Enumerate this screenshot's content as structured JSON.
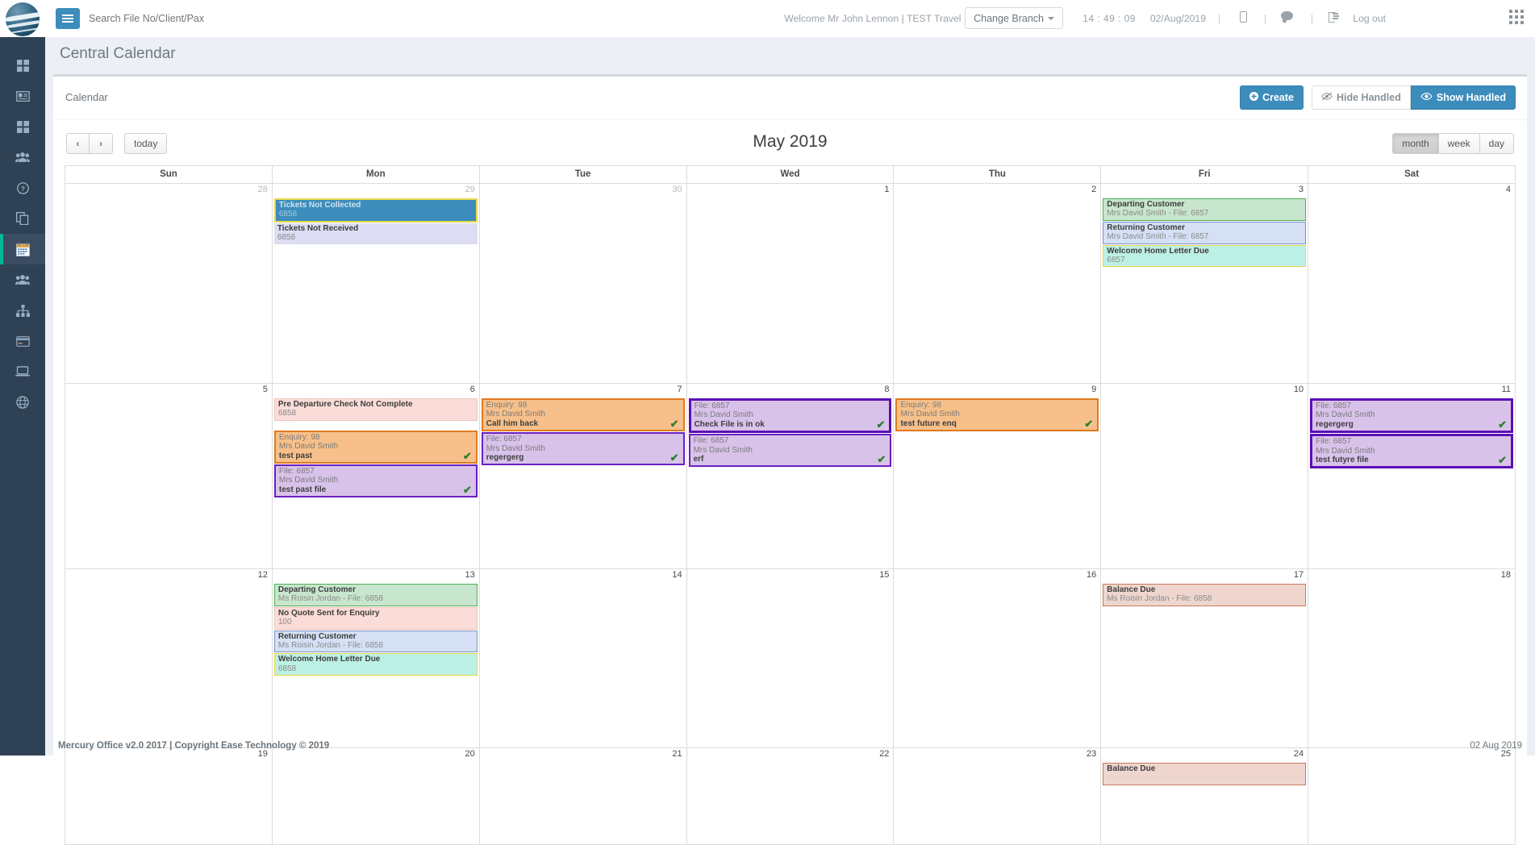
{
  "header": {
    "search_placeholder": "Search File No/Client/Pax",
    "welcome": "Welcome Mr John Lennon | TEST Travel |",
    "change_branch": "Change Branch",
    "time": "14 : 49 : 09",
    "date": "02/Aug/2019",
    "logout": "Log out",
    "separator": "|",
    "icons": {
      "menu": "hamburger-icon",
      "mobile": "mobile-icon",
      "chat": "chat-icon",
      "logout": "sign-out-icon",
      "apps": "apps-grid-icon",
      "logo": "company-logo"
    }
  },
  "sidebar": {
    "items": [
      {
        "name": "dashboard",
        "icon": "grid-icon"
      },
      {
        "name": "id-card",
        "icon": "id-card-icon"
      },
      {
        "name": "modules",
        "icon": "grid-icon"
      },
      {
        "name": "customers",
        "icon": "users-icon"
      },
      {
        "name": "help",
        "icon": "question-circle-icon"
      },
      {
        "name": "documents",
        "icon": "copy-icon"
      },
      {
        "name": "calendar",
        "icon": "calendar-icon",
        "active": true
      },
      {
        "name": "suppliers",
        "icon": "users-group-icon"
      },
      {
        "name": "structure",
        "icon": "sitemap-icon"
      },
      {
        "name": "payments",
        "icon": "credit-card-icon"
      },
      {
        "name": "reports",
        "icon": "laptop-icon"
      },
      {
        "name": "globe",
        "icon": "globe-icon"
      }
    ]
  },
  "page": {
    "title": "Central Calendar",
    "card_title": "Calendar"
  },
  "actions": {
    "create": "Create",
    "hide_handled": "Hide Handled",
    "show_handled": "Show Handled"
  },
  "calendar": {
    "title": "May 2019",
    "prev": "‹",
    "next": "›",
    "today": "today",
    "views": [
      {
        "label": "month",
        "selected": true
      },
      {
        "label": "week",
        "selected": false
      },
      {
        "label": "day",
        "selected": false
      }
    ],
    "weekdays": [
      "Sun",
      "Mon",
      "Tue",
      "Wed",
      "Thu",
      "Fri",
      "Sat"
    ],
    "weeks": [
      {
        "days": [
          {
            "num": "28",
            "other": true,
            "events": []
          },
          {
            "num": "29",
            "other": true,
            "events": [
              {
                "style": "selected",
                "title": "Tickets Not Collected",
                "sub": "6858"
              },
              {
                "style": "lavender",
                "title": "Tickets Not Received",
                "sub": "6858"
              }
            ]
          },
          {
            "num": "30",
            "other": true,
            "events": []
          },
          {
            "num": "1",
            "other": false,
            "events": []
          },
          {
            "num": "2",
            "other": false,
            "events": []
          },
          {
            "num": "3",
            "other": false,
            "events": [
              {
                "style": "green",
                "title": "Departing Customer",
                "sub": "Mrs David Smith - File: 6857"
              },
              {
                "style": "blue",
                "title": "Returning Customer",
                "sub": "Mrs David Smith - File: 6857"
              },
              {
                "style": "cyan",
                "title": "Welcome Home Letter Due",
                "sub": "6857"
              }
            ]
          },
          {
            "num": "4",
            "other": false,
            "events": []
          }
        ]
      },
      {
        "days": [
          {
            "num": "5",
            "other": false,
            "events": []
          },
          {
            "num": "6",
            "other": false,
            "events": [
              {
                "style": "pink",
                "title": "Pre Departure Check Not Complete",
                "sub": "6858"
              },
              {
                "style": "gap"
              },
              {
                "style": "orange",
                "l1": "Enquiry: 98",
                "l2": "Mrs David Smith",
                "l3": "test past",
                "tick": true
              },
              {
                "style": "purple",
                "l1": "File: 6857",
                "l2": "Mrs David Smith",
                "l3": "test past file",
                "tick": true
              }
            ]
          },
          {
            "num": "7",
            "other": false,
            "events": [
              {
                "style": "orange",
                "l1": "Enquiry: 98",
                "l2": "Mrs David Smith",
                "l3": "Call him back",
                "tick": true
              },
              {
                "style": "purple",
                "l1": "File: 6857",
                "l2": "Mrs David Smith",
                "l3": "regergerg",
                "tick": true
              }
            ]
          },
          {
            "num": "8",
            "other": false,
            "events": [
              {
                "style": "purple-sel",
                "l1": "File: 6857",
                "l2": "Mrs David Smith",
                "l3": "Check File is in ok",
                "tick": true
              },
              {
                "style": "purple",
                "l1": "File: 6857",
                "l2": "Mrs David Smith",
                "l3": "erf",
                "tick": true
              }
            ]
          },
          {
            "num": "9",
            "other": false,
            "events": [
              {
                "style": "orange",
                "l1": "Enquiry: 98",
                "l2": "Mrs David Smith",
                "l3": "test future enq",
                "tick": true
              }
            ]
          },
          {
            "num": "10",
            "other": false,
            "events": []
          },
          {
            "num": "11",
            "other": false,
            "events": [
              {
                "style": "purple-sel",
                "l1": "File: 6857",
                "l2": "Mrs David Smith",
                "l3": "regergerg",
                "tick": true
              },
              {
                "style": "purple-sel",
                "l1": "File: 6857",
                "l2": "Mrs David Smith",
                "l3": "test futyre file",
                "tick": true
              }
            ]
          }
        ]
      },
      {
        "days": [
          {
            "num": "12",
            "other": false,
            "events": []
          },
          {
            "num": "13",
            "other": false,
            "events": [
              {
                "style": "green",
                "title": "Departing Customer",
                "sub": "Ms Roisin Jordan - File: 6858"
              },
              {
                "style": "pink",
                "title": "No Quote Sent for Enquiry",
                "sub": "100"
              },
              {
                "style": "blue",
                "title": "Returning Customer",
                "sub": "Ms Roisin Jordan - File: 6858"
              },
              {
                "style": "cyan",
                "title": "Welcome Home Letter Due",
                "sub": "6858"
              }
            ]
          },
          {
            "num": "14",
            "other": false,
            "events": []
          },
          {
            "num": "15",
            "other": false,
            "events": []
          },
          {
            "num": "16",
            "other": false,
            "events": []
          },
          {
            "num": "17",
            "other": false,
            "events": [
              {
                "style": "salmon",
                "title": "Balance Due",
                "sub": "Ms Roisin Jordan - File: 6858"
              }
            ]
          },
          {
            "num": "18",
            "other": false,
            "events": []
          }
        ]
      },
      {
        "days": [
          {
            "num": "19",
            "other": false,
            "events": []
          },
          {
            "num": "20",
            "other": false,
            "events": []
          },
          {
            "num": "21",
            "other": false,
            "events": []
          },
          {
            "num": "22",
            "other": false,
            "events": []
          },
          {
            "num": "23",
            "other": false,
            "events": []
          },
          {
            "num": "24",
            "other": false,
            "events": [
              {
                "style": "salmon",
                "title": "Balance Due",
                "sub": ""
              }
            ]
          },
          {
            "num": "25",
            "other": false,
            "events": []
          }
        ]
      }
    ]
  },
  "footer": {
    "left": "Mercury Office v2.0 2017 | Copyright Ease Technology © 2019",
    "right": "02 Aug 2019"
  },
  "colors": {
    "accent": "#3c8dbc",
    "sidebar": "#2f4154",
    "active_marker": "#00b894",
    "page_bg": "#ecf0f5"
  }
}
